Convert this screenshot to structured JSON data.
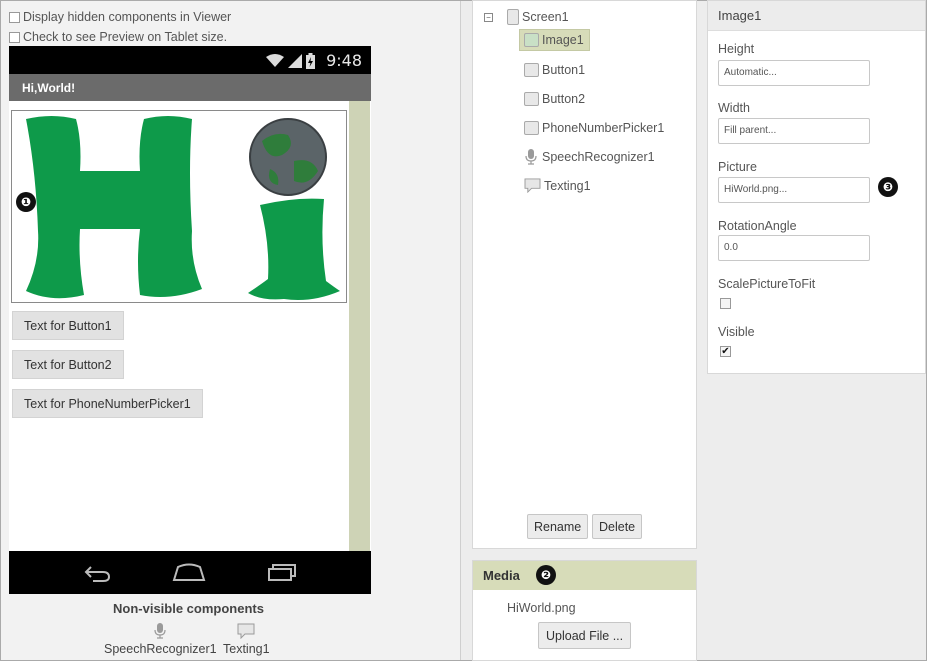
{
  "viewer": {
    "display_hidden_label": "Display hidden components in Viewer",
    "tablet_preview_label": "Check to see Preview on Tablet size.",
    "status_time": "9:48",
    "app_title": "Hi,World!",
    "buttons": [
      "Text for Button1",
      "Text for Button2",
      "Text for PhoneNumberPicker1"
    ],
    "nonvisible_title": "Non-visible components",
    "nonvisible_items": [
      "SpeechRecognizer1",
      "Texting1"
    ]
  },
  "badges": [
    "❶",
    "❷",
    "❸"
  ],
  "components": {
    "root": "Screen1",
    "items": [
      "Image1",
      "Button1",
      "Button2",
      "PhoneNumberPicker1",
      "SpeechRecognizer1",
      "Texting1"
    ],
    "rename_label": "Rename",
    "delete_label": "Delete"
  },
  "media": {
    "title": "Media",
    "file": "HiWorld.png",
    "upload_label": "Upload File ..."
  },
  "properties": {
    "title": "Image1",
    "height_label": "Height",
    "height_value": "Automatic...",
    "width_label": "Width",
    "width_value": "Fill parent...",
    "picture_label": "Picture",
    "picture_value": "HiWorld.png...",
    "rotation_label": "RotationAngle",
    "rotation_value": "0.0",
    "scale_label": "ScalePictureToFit",
    "scale_checked": false,
    "visible_label": "Visible",
    "visible_checked": true,
    "check_mark": "✔"
  },
  "colors": {
    "accent": "#d7dcb9",
    "hi_green": "#0e9a4a"
  }
}
